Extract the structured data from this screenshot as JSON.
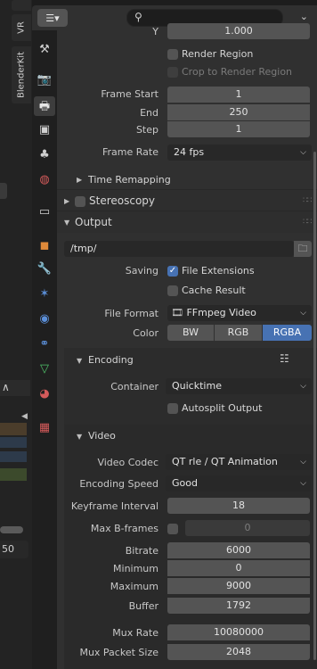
{
  "left_strip": {
    "tabs": [
      "VR",
      "BlenderKit"
    ],
    "partial_value": "50"
  },
  "header": {
    "editor_type_icon": "properties-editor-icon",
    "search_placeholder": "",
    "chevron": "⌄"
  },
  "dimensions": {
    "y_label": "Y",
    "y_value": "1.000",
    "render_region_label": "Render Region",
    "crop_label": "Crop to Render Region",
    "frame_start_label": "Frame Start",
    "frame_start": "1",
    "end_label": "End",
    "end": "250",
    "step_label": "Step",
    "step": "1",
    "frame_rate_label": "Frame Rate",
    "frame_rate": "24 fps",
    "time_remapping": "Time Remapping"
  },
  "stereoscopy": {
    "label": "Stereoscopy"
  },
  "output": {
    "title": "Output",
    "path": "/tmp/",
    "saving_label": "Saving",
    "file_extensions": "File Extensions",
    "cache_result": "Cache Result",
    "file_format_label": "File Format",
    "file_format": "FFmpeg Video",
    "color_label": "Color",
    "color_options": [
      "BW",
      "RGB",
      "RGBA"
    ],
    "color_selected": "RGBA"
  },
  "encoding": {
    "title": "Encoding",
    "container_label": "Container",
    "container": "Quicktime",
    "autosplit": "Autosplit Output"
  },
  "video": {
    "title": "Video",
    "codec_label": "Video Codec",
    "codec": "QT rle / QT Animation",
    "speed_label": "Encoding Speed",
    "speed": "Good",
    "keyframe_label": "Keyframe Interval",
    "keyframe": "18",
    "bframes_label": "Max B-frames",
    "bframes": "0",
    "bitrate_label": "Bitrate",
    "bitrate": "6000",
    "minimum_label": "Minimum",
    "minimum": "0",
    "maximum_label": "Maximum",
    "maximum": "9000",
    "buffer_label": "Buffer",
    "buffer": "1792",
    "muxrate_label": "Mux Rate",
    "muxrate": "10080000",
    "muxpacket_label": "Mux Packet Size",
    "muxpacket": "2048"
  },
  "tabs": [
    "tool-tab-icon",
    "render-tab-icon",
    "output-tab-icon",
    "view-layer-tab-icon",
    "scene-tab-icon",
    "world-tab-icon",
    "collection-tab-icon",
    "object-tab-icon",
    "modifier-tab-icon",
    "particles-tab-icon",
    "physics-tab-icon",
    "constraints-tab-icon",
    "data-tab-icon",
    "material-tab-icon",
    "texture-tab-icon"
  ],
  "colors": {
    "accent": "#4772b3",
    "panel": "#303030",
    "field": "#545454"
  }
}
